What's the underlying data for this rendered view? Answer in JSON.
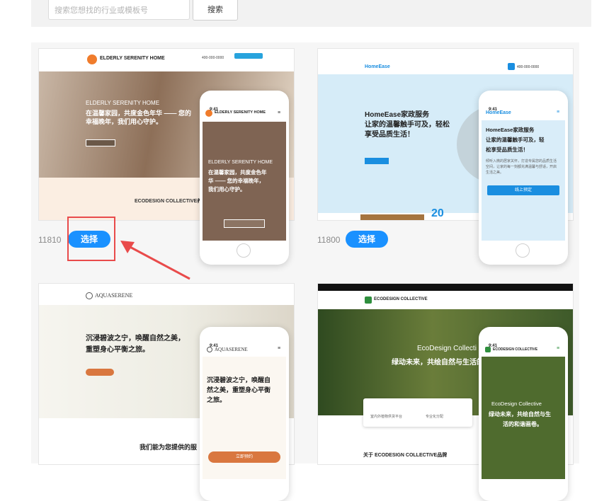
{
  "search": {
    "placeholder": "搜索您想找的行业或模板号",
    "button_label": "搜索"
  },
  "cards": [
    {
      "code": "11810",
      "select_label": "选择",
      "desktop": {
        "logo": "ELDERLY SERENITY HOME",
        "phone_number": "400-000-0000",
        "hero_en": "ELDERLY SERENITY HOME",
        "hero_line1": "在温馨家园，共度金色年华 —— 您的",
        "hero_line2": "幸福晚年，我们用心守护。",
        "section_title": "ECODESIGN COLLECTIVE养老"
      },
      "phone": {
        "time": "9:41",
        "logo": "ELDERLY SERENITY HOME",
        "hero_en": "ELDERLY SERENITY HOME",
        "hero_line1": "在温馨家园，共度金色年",
        "hero_line2": "华 —— 您的幸福晚年，",
        "hero_line3": "我们用心守护。"
      }
    },
    {
      "code": "11800",
      "select_label": "选择",
      "desktop": {
        "logo": "HomeEase",
        "phone_number": "400-000-0000",
        "hero_line1": "HomeEase家政服务",
        "hero_line2": "让家的温馨触手可及，轻松",
        "hero_line3": "享受品质生活！",
        "stat": "20"
      },
      "phone": {
        "time": "9:41",
        "logo": "HomeEase",
        "hero_line1": "HomeEase家政服务",
        "hero_line2": "让家的温馨触手可及，轻",
        "hero_line3": "松享受品质生活！",
        "desc": "倾听入微的居家关怀，打造专属您的品质生活空间，让家的每一刻都充满温馨与舒适，开启生活之美。",
        "cta": "线上预定"
      }
    },
    {
      "desktop": {
        "logo": "AQUASERENE",
        "hero_line1": "沉浸碧波之宁，唤醒自然之美，",
        "hero_line2": "重塑身心平衡之旅。",
        "section_title": "我们能为您提供的服"
      },
      "phone": {
        "time": "9:41",
        "logo": "AQUASERENE",
        "hero_line1": "沉浸碧波之宁，唤醒自",
        "hero_line2": "然之美，重塑身心平衡",
        "hero_line3": "之旅。",
        "cta": "立即预约"
      }
    },
    {
      "desktop": {
        "logo": "ECODESIGN COLLECTIVE",
        "hero_en": "EcoDesign Collecti",
        "hero_line1": "绿动未来，共绘自然与生活的",
        "section_title": "关于 ECODESIGN COLLECTIVE品牌",
        "feature1": "室内外植物供货平台",
        "feature2": "专业化分配"
      },
      "phone": {
        "time": "9:41",
        "logo": "ECODESIGN COLLECTIVE",
        "hero_en": "EcoDesign Collective",
        "hero_line1": "绿动未来，共绘自然与生",
        "hero_line2": "活的和谐画卷。"
      }
    }
  ]
}
